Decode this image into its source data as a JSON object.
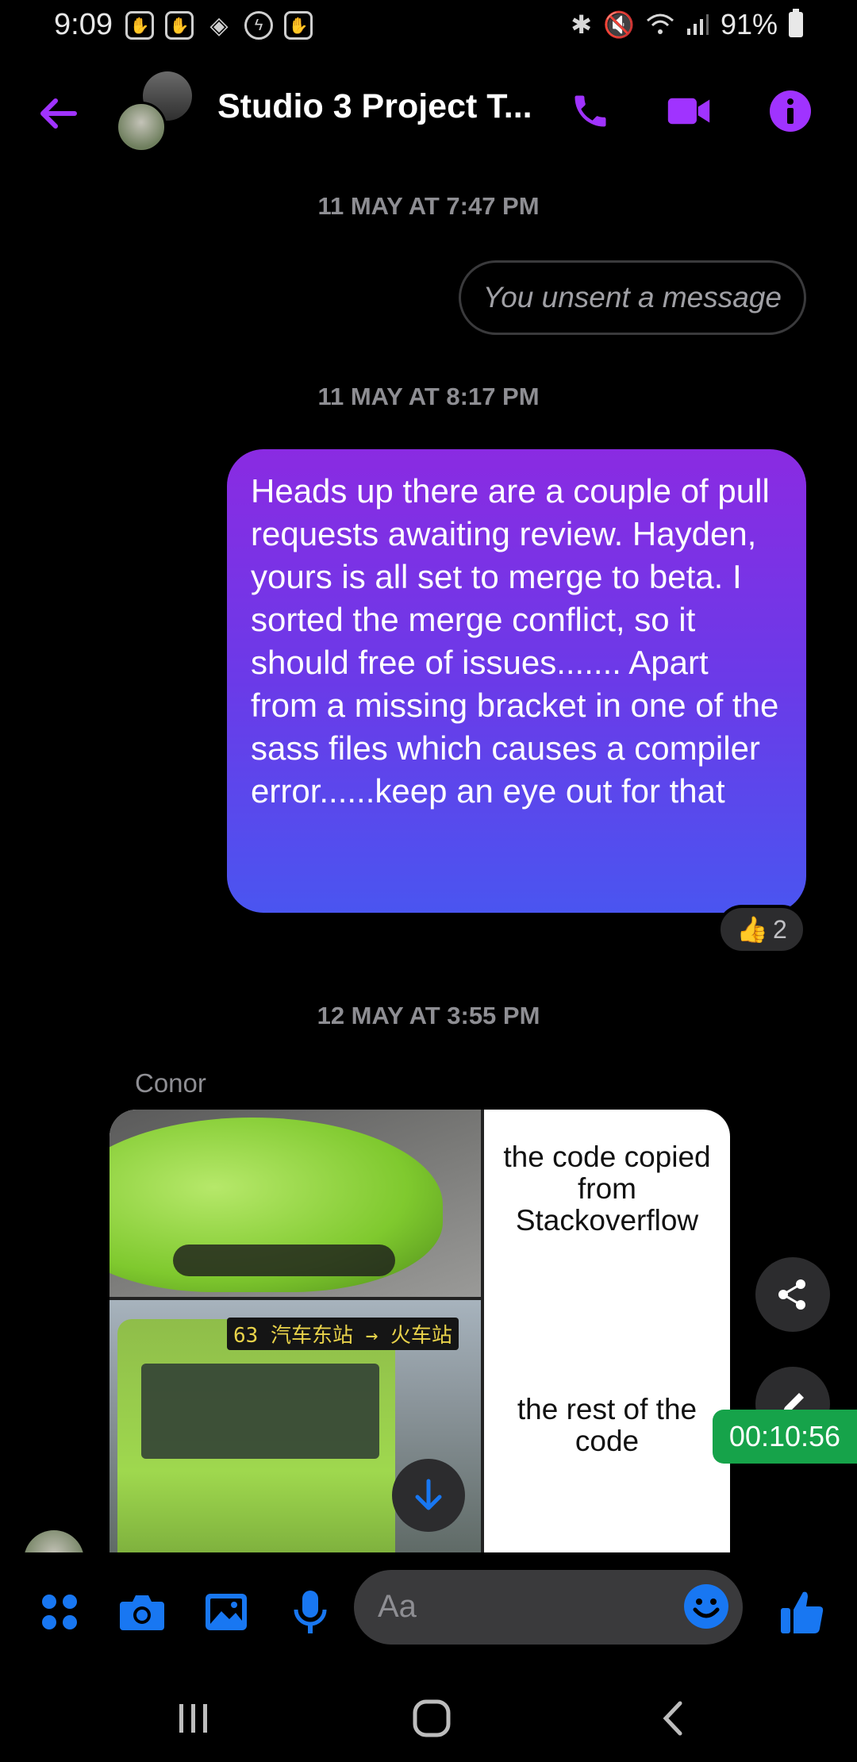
{
  "status_bar": {
    "time": "9:09",
    "battery": "91%",
    "left_icons": [
      "hand-icon",
      "hand-icon",
      "binance-icon",
      "messenger-icon",
      "hand-icon"
    ],
    "right_icons": [
      "bluetooth-icon",
      "mute-icon",
      "wifi-icon",
      "signal-icon",
      "battery-icon"
    ]
  },
  "header": {
    "title": "Studio 3 Project T...",
    "accent_color": "#a033ff"
  },
  "chat": {
    "timestamp_1": "11 MAY AT 7:47 PM",
    "unsent_text": "You unsent a message",
    "timestamp_2": "11 MAY AT 8:17 PM",
    "message_text": "Heads up there are a couple of pull requests awaiting review. Hayden, yours is all set to merge to beta. I sorted the merge conflict, so it should free of issues....... Apart from a missing bracket in one of the sass files which causes a compiler error......keep an eye out for that",
    "reaction_emoji": "👍",
    "reaction_count": "2",
    "timestamp_3": "12 MAY AT 3:55 PM",
    "sender_name": "Conor",
    "meme": {
      "top_caption": "the code copied from Stackoverflow",
      "bottom_caption": "the rest of the code",
      "bus_sign": "63 汽车东站 → 火车站"
    }
  },
  "overlay": {
    "timer": "00:10:56"
  },
  "composer": {
    "placeholder": "Aa",
    "accent_color": "#1877f2"
  }
}
